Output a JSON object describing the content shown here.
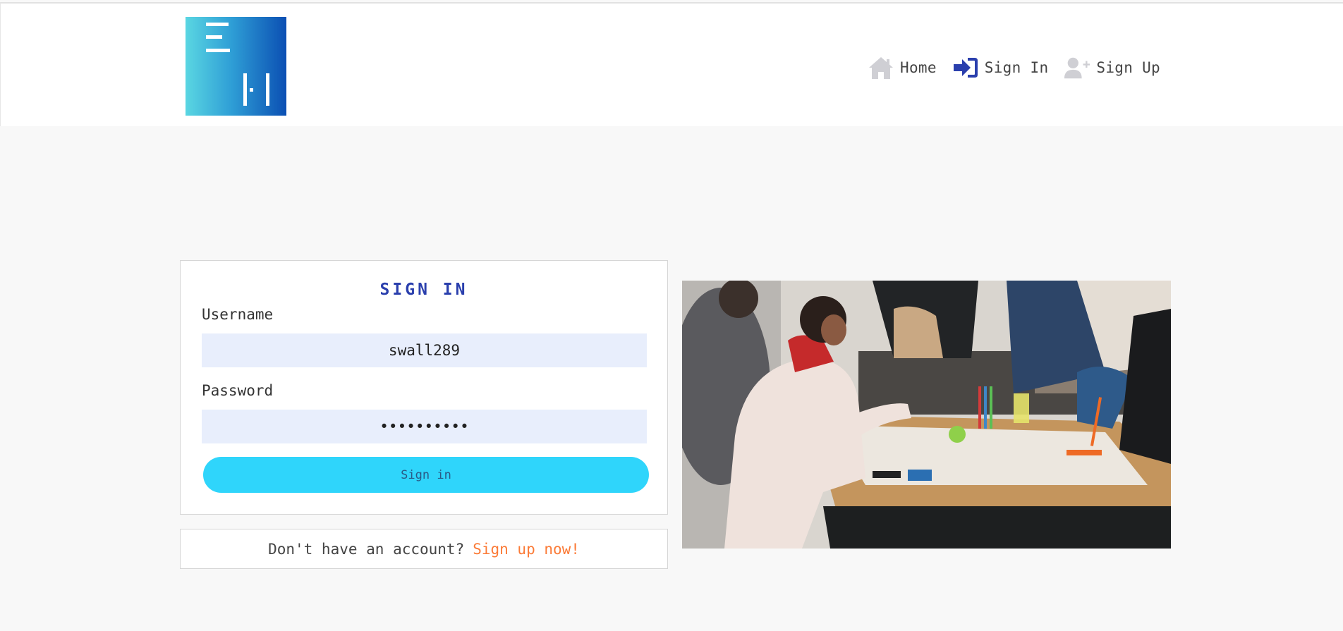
{
  "header": {
    "logo_alt": "logo",
    "nav": [
      {
        "label": "Home",
        "icon": "home-icon"
      },
      {
        "label": "Sign In",
        "icon": "sign-in-icon"
      },
      {
        "label": "Sign Up",
        "icon": "add-user-icon"
      }
    ]
  },
  "form": {
    "title": "SIGN IN",
    "username_label": "Username",
    "username_value": "swall289",
    "password_label": "Password",
    "password_value": "**********",
    "submit_label": "Sign in"
  },
  "signup": {
    "prompt": "Don't have an account?",
    "link": "Sign up now!"
  },
  "colors": {
    "accent_blue": "#2a3fad",
    "button_cyan": "#2fd5fb",
    "link_orange": "#fb7a36",
    "input_bg": "#e8eefc"
  }
}
